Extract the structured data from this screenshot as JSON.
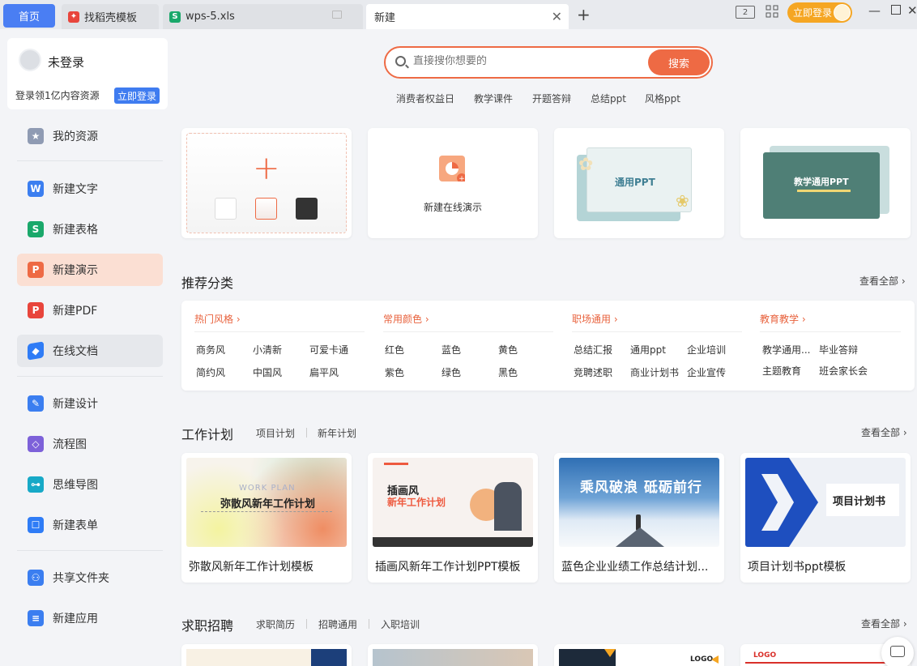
{
  "tabs": {
    "home": "首页",
    "templates": "找稻壳模板",
    "file": "wps-5.xls",
    "new": "新建",
    "template_icon_color": "#e8453c",
    "file_icon_color": "#1aa86b"
  },
  "titlebar": {
    "login_label": "立即登录"
  },
  "user": {
    "name": "未登录",
    "promo": "登录领1亿内容资源",
    "login_label": "立即登录"
  },
  "nav": [
    {
      "label": "我的资源",
      "icon": "star-icon",
      "color": "#8f9bb3"
    },
    {
      "label": "新建文字",
      "icon": "doc-w-icon",
      "color": "#3b7ef0"
    },
    {
      "label": "新建表格",
      "icon": "sheet-s-icon",
      "color": "#1aa86b"
    },
    {
      "label": "新建演示",
      "icon": "ppt-p-icon",
      "color": "#ee6a44"
    },
    {
      "label": "新建PDF",
      "icon": "pdf-icon",
      "color": "#e8453c"
    },
    {
      "label": "在线文档",
      "icon": "cloud-doc-icon",
      "color": "#2f7cf6"
    },
    {
      "label": "新建设计",
      "icon": "design-icon",
      "color": "#3b7ef0"
    },
    {
      "label": "流程图",
      "icon": "flowchart-icon",
      "color": "#7d61d9"
    },
    {
      "label": "思维导图",
      "icon": "mindmap-icon",
      "color": "#17a9c7"
    },
    {
      "label": "新建表单",
      "icon": "form-icon",
      "color": "#2f7cf6"
    },
    {
      "label": "共享文件夹",
      "icon": "share-folder-icon",
      "color": "#3b7ef0"
    },
    {
      "label": "新建应用",
      "icon": "app-icon",
      "color": "#3b7ef0"
    }
  ],
  "search": {
    "placeholder": "直接搜你想要的",
    "button": "搜索",
    "hot": [
      "消费者权益日",
      "教学课件",
      "开题答辩",
      "总结ppt",
      "风格ppt"
    ]
  },
  "top_cards": {
    "online_label": "新建在线演示",
    "tpl1": "通用PPT",
    "tpl2": "教学通用PPT"
  },
  "recommend": {
    "title": "推荐分类",
    "see_all": "查看全部",
    "groups": [
      {
        "head": "热门风格",
        "items": [
          "商务风",
          "小清新",
          "可爱卡通",
          "简约风",
          "中国风",
          "扁平风"
        ]
      },
      {
        "head": "常用颜色",
        "items": [
          "红色",
          "蓝色",
          "黄色",
          "紫色",
          "绿色",
          "黑色"
        ]
      },
      {
        "head": "职场通用",
        "items": [
          "总结汇报",
          "通用ppt",
          "企业培训",
          "竞聘述职",
          "商业计划书",
          "企业宣传"
        ]
      },
      {
        "head": "教育教学",
        "items": [
          "教学通用...",
          "毕业答辩",
          "主题教育",
          "班会家长会"
        ]
      }
    ]
  },
  "work": {
    "title": "工作计划",
    "subs": [
      "项目计划",
      "新年计划"
    ],
    "see_all": "查看全部",
    "templates": [
      {
        "title": "弥散风新年工作计划模板",
        "thumb_en": "WORK PLAN",
        "thumb_cn": "弥散风新年工作计划"
      },
      {
        "title": "插画风新年工作计划PPT模板",
        "thumb_cn1": "插画风",
        "thumb_cn2": "新年工作计划"
      },
      {
        "title": "蓝色企业业绩工作总结计划...",
        "thumb_cn": "乘风破浪 砥砺前行"
      },
      {
        "title": "项目计划书ppt模板",
        "thumb_cn": "项目计划书"
      }
    ]
  },
  "jobs": {
    "title": "求职招聘",
    "subs": [
      "求职简历",
      "招聘通用",
      "入职培训"
    ],
    "see_all": "查看全部",
    "thumb_logo": "LOGO"
  }
}
